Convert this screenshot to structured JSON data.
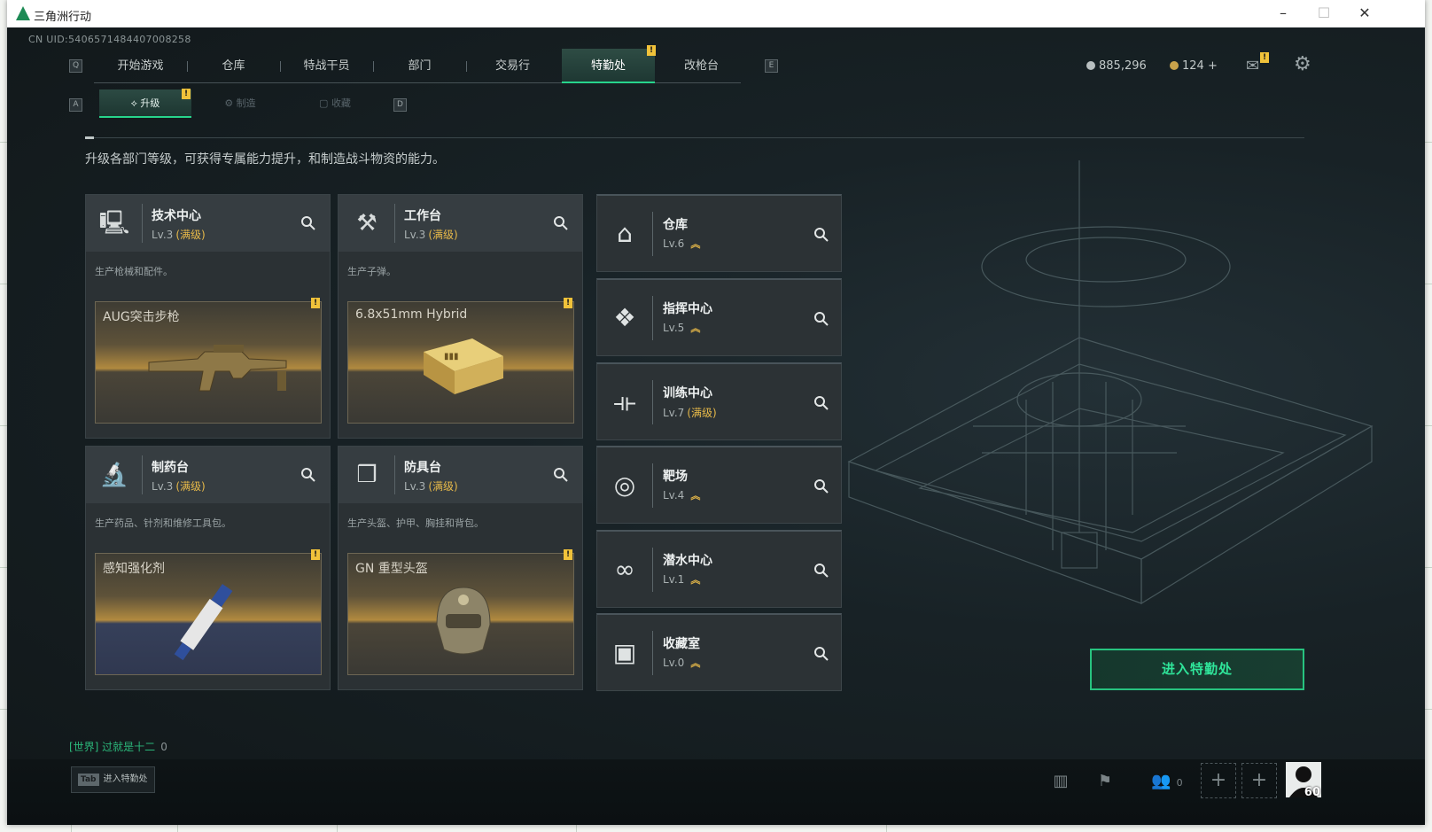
{
  "window": {
    "title": "三角洲行动"
  },
  "uid": "CN UID:5406571484407008258",
  "nav": {
    "left_key": "Q",
    "right_key": "E",
    "tabs": [
      {
        "label": "开始游戏"
      },
      {
        "label": "仓库"
      },
      {
        "label": "特战干员"
      },
      {
        "label": "部门"
      },
      {
        "label": "交易行"
      },
      {
        "label": "特勤处",
        "active": true
      },
      {
        "label": "改枪台"
      }
    ]
  },
  "currency": {
    "silver": "885,296",
    "gold": "124"
  },
  "subtabs": {
    "left_key": "A",
    "right_key": "D",
    "tabs": [
      {
        "label": "升级",
        "active": true
      },
      {
        "label": "制造"
      },
      {
        "label": "收藏"
      }
    ]
  },
  "description": "升级各部门等级，可获得专属能力提升，和制造战斗物资的能力。",
  "departments": [
    {
      "name": "技术中心",
      "level": "Lv.3",
      "status": "(满级)",
      "desc": "生产枪械和配件。",
      "product": "AUG突击步枪",
      "icon": "monitor-icon"
    },
    {
      "name": "工作台",
      "level": "Lv.3",
      "status": "(满级)",
      "desc": "生产子弹。",
      "product": "6.8x51mm Hybrid",
      "icon": "hammer-wrench-icon"
    },
    {
      "name": "制药台",
      "level": "Lv.3",
      "status": "(满级)",
      "desc": "生产药品、针剂和维修工具包。",
      "product": "感知强化剂",
      "icon": "microscope-icon"
    },
    {
      "name": "防具台",
      "level": "Lv.3",
      "status": "(满级)",
      "desc": "生产头盔、护甲、胸挂和背包。",
      "product": "GN 重型头盔",
      "icon": "cubes-icon"
    }
  ],
  "facilities": [
    {
      "name": "仓库",
      "level": "Lv.6",
      "status": "",
      "icon": "warehouse-icon"
    },
    {
      "name": "指挥中心",
      "level": "Lv.5",
      "status": "",
      "icon": "command-icon"
    },
    {
      "name": "训练中心",
      "level": "Lv.7",
      "status": "(满级)",
      "icon": "dumbbell-icon"
    },
    {
      "name": "靶场",
      "level": "Lv.4",
      "status": "",
      "icon": "target-icon"
    },
    {
      "name": "潜水中心",
      "level": "Lv.1",
      "status": "",
      "icon": "goggles-icon"
    },
    {
      "name": "收藏室",
      "level": "Lv.0",
      "status": "",
      "icon": "vault-icon"
    }
  ],
  "enter_button": "进入特勤处",
  "chat": {
    "channel": "[世界] 过就是十二",
    "count": "0"
  },
  "bottom": {
    "tab_key": "Tab",
    "tab_label": "进入特勤处",
    "friends_count": "0",
    "player_level": "60"
  }
}
